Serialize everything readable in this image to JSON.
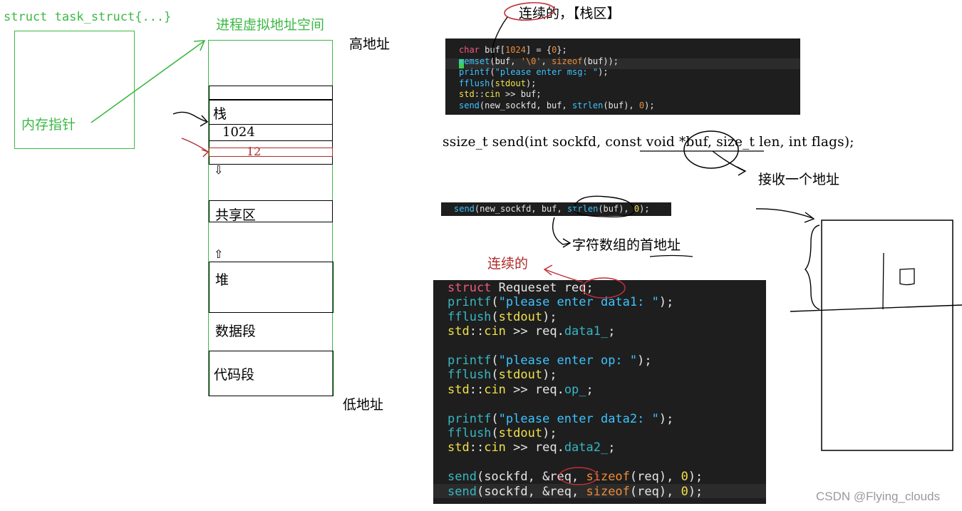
{
  "left": {
    "task_struct_label": "struct task_struct{...}",
    "mem_pointer_label": "内存指针",
    "vaddr_title": "进程虚拟地址空间",
    "high_addr": "高地址",
    "low_addr": "低地址",
    "stack_label": "栈",
    "value_1024": "1024",
    "value_12": "12",
    "shared_label": "共享区",
    "heap_label": "堆",
    "data_seg_label": "数据段",
    "code_seg_label": "代码段",
    "down_arrow": "⇩",
    "up_arrow": "⇧"
  },
  "annotations": {
    "contiguous_stack": "连续的，【栈区】",
    "receive_address": "接收一个地址",
    "char_array_addr": "字符数组的首地址",
    "contiguous": "连续的"
  },
  "signature": "ssize_t send(int sockfd, const void *buf, size_t len, int flags);",
  "code_block_1": [
    [
      {
        "t": "char",
        "c": "kw-pink"
      },
      {
        "t": " buf[",
        "c": "plain"
      },
      {
        "t": "1024",
        "c": "kw-orange"
      },
      {
        "t": "] = {",
        "c": "plain"
      },
      {
        "t": "0",
        "c": "kw-orange"
      },
      {
        "t": "};",
        "c": "plain"
      }
    ],
    [
      {
        "t": "memset",
        "c": "kw-cyan"
      },
      {
        "t": "(buf, ",
        "c": "plain"
      },
      {
        "t": "'\\0'",
        "c": "kw-orange"
      },
      {
        "t": ", ",
        "c": "plain"
      },
      {
        "t": "sizeof",
        "c": "kw-orange"
      },
      {
        "t": "(buf));",
        "c": "plain"
      }
    ],
    [
      {
        "t": "printf",
        "c": "kw-cyan"
      },
      {
        "t": "(",
        "c": "plain"
      },
      {
        "t": "\"please enter msg: \"",
        "c": "kw-cyan"
      },
      {
        "t": ");",
        "c": "plain"
      }
    ],
    [
      {
        "t": "fflush",
        "c": "kw-cyan"
      },
      {
        "t": "(",
        "c": "plain"
      },
      {
        "t": "stdout",
        "c": "kw-yellow"
      },
      {
        "t": ");",
        "c": "plain"
      }
    ],
    [
      {
        "t": "std",
        "c": "kw-yellow"
      },
      {
        "t": "::",
        "c": "plain"
      },
      {
        "t": "cin",
        "c": "kw-yellow"
      },
      {
        "t": " >> buf;",
        "c": "plain"
      }
    ],
    [
      {
        "t": "send",
        "c": "kw-cyan"
      },
      {
        "t": "(new_sockfd, buf, ",
        "c": "plain"
      },
      {
        "t": "strlen",
        "c": "kw-cyan"
      },
      {
        "t": "(buf), ",
        "c": "plain"
      },
      {
        "t": "0",
        "c": "kw-orange"
      },
      {
        "t": ");",
        "c": "plain"
      }
    ]
  ],
  "code_block_2": [
    [
      {
        "t": "send",
        "c": "kw-cyan"
      },
      {
        "t": "(new_sockfd, buf, ",
        "c": "plain"
      },
      {
        "t": "strlen",
        "c": "kw-cyan"
      },
      {
        "t": "(buf), ",
        "c": "plain"
      },
      {
        "t": "0",
        "c": "kw-yellow"
      },
      {
        "t": ");",
        "c": "plain"
      }
    ]
  ],
  "code_block_3": [
    [
      {
        "t": "struct",
        "c": "kw-pink"
      },
      {
        "t": " Requeset req;",
        "c": "plain"
      }
    ],
    [
      {
        "t": "printf",
        "c": "kw-teal"
      },
      {
        "t": "(",
        "c": "plain"
      },
      {
        "t": "\"please enter data1: \"",
        "c": "kw-cyan"
      },
      {
        "t": ");",
        "c": "plain"
      }
    ],
    [
      {
        "t": "fflush",
        "c": "kw-teal"
      },
      {
        "t": "(",
        "c": "plain"
      },
      {
        "t": "stdout",
        "c": "kw-yellow"
      },
      {
        "t": ");",
        "c": "plain"
      }
    ],
    [
      {
        "t": "std",
        "c": "kw-yellow"
      },
      {
        "t": "::",
        "c": "plain"
      },
      {
        "t": "cin",
        "c": "kw-yellow"
      },
      {
        "t": " >> req.",
        "c": "plain"
      },
      {
        "t": "data1_",
        "c": "kw-teal"
      },
      {
        "t": ";",
        "c": "plain"
      }
    ],
    [],
    [
      {
        "t": "printf",
        "c": "kw-teal"
      },
      {
        "t": "(",
        "c": "plain"
      },
      {
        "t": "\"please enter op: \"",
        "c": "kw-cyan"
      },
      {
        "t": ");",
        "c": "plain"
      }
    ],
    [
      {
        "t": "fflush",
        "c": "kw-teal"
      },
      {
        "t": "(",
        "c": "plain"
      },
      {
        "t": "stdout",
        "c": "kw-yellow"
      },
      {
        "t": ");",
        "c": "plain"
      }
    ],
    [
      {
        "t": "std",
        "c": "kw-yellow"
      },
      {
        "t": "::",
        "c": "plain"
      },
      {
        "t": "cin",
        "c": "kw-yellow"
      },
      {
        "t": " >> req.",
        "c": "plain"
      },
      {
        "t": "op_",
        "c": "kw-teal"
      },
      {
        "t": ";",
        "c": "plain"
      }
    ],
    [],
    [
      {
        "t": "printf",
        "c": "kw-teal"
      },
      {
        "t": "(",
        "c": "plain"
      },
      {
        "t": "\"please enter data2: \"",
        "c": "kw-cyan"
      },
      {
        "t": ");",
        "c": "plain"
      }
    ],
    [
      {
        "t": "fflush",
        "c": "kw-teal"
      },
      {
        "t": "(",
        "c": "plain"
      },
      {
        "t": "stdout",
        "c": "kw-yellow"
      },
      {
        "t": ");",
        "c": "plain"
      }
    ],
    [
      {
        "t": "std",
        "c": "kw-yellow"
      },
      {
        "t": "::",
        "c": "plain"
      },
      {
        "t": "cin",
        "c": "kw-yellow"
      },
      {
        "t": " >> req.",
        "c": "plain"
      },
      {
        "t": "data2_",
        "c": "kw-teal"
      },
      {
        "t": ";",
        "c": "plain"
      }
    ],
    [],
    [
      {
        "t": "send",
        "c": "kw-teal"
      },
      {
        "t": "(sockfd, &req, ",
        "c": "plain"
      },
      {
        "t": "sizeof",
        "c": "kw-orange"
      },
      {
        "t": "(req), ",
        "c": "plain"
      },
      {
        "t": "0",
        "c": "kw-yellow"
      },
      {
        "t": ");",
        "c": "plain"
      }
    ],
    [
      {
        "t": "send",
        "c": "kw-teal"
      },
      {
        "t": "(sockfd, &req, ",
        "c": "plain"
      },
      {
        "t": "sizeof",
        "c": "kw-orange"
      },
      {
        "t": "(req), ",
        "c": "plain"
      },
      {
        "t": "0",
        "c": "kw-yellow"
      },
      {
        "t": ");",
        "c": "plain"
      }
    ]
  ],
  "watermark": "CSDN @Flying_clouds",
  "colors": {
    "green": "#3cb844",
    "red": "#c0303a",
    "code_bg": "#1e1e1e"
  }
}
